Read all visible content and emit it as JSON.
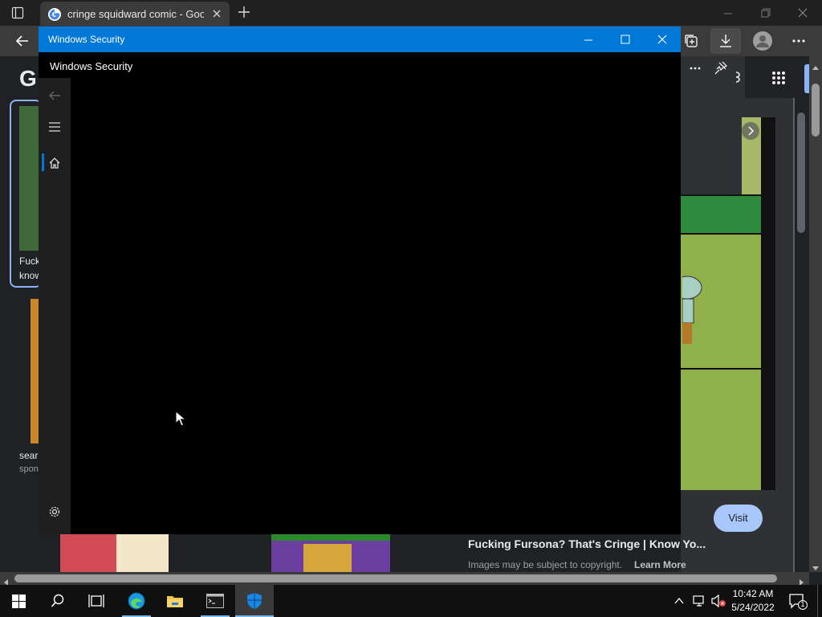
{
  "browser": {
    "tab_title": "cringe squidward comic - Google",
    "page": {
      "google_letter": "G",
      "left_card_text": [
        "Fuck",
        "know"
      ],
      "left_card2_text": [
        "sear",
        "spon"
      ],
      "result_title": "Fucking Fursona? That's Cringe | Know Yo...",
      "copyright_text": "Images may be subject to copyright.",
      "learn_more": "Learn More",
      "visit_button": "Visit"
    }
  },
  "window": {
    "title": "Windows Security",
    "app_header": "Windows Security",
    "nav_items": [
      "back-icon",
      "menu-icon",
      "home-icon",
      "settings-icon"
    ]
  },
  "taskbar": {
    "items": [
      "start",
      "search",
      "task-view",
      "edge",
      "file-explorer",
      "terminal",
      "windows-security"
    ],
    "time": "10:42 AM",
    "date": "5/24/2022",
    "notification_count": "1"
  },
  "colors": {
    "title_bar": "#0078d7",
    "taskbar": "#101010",
    "browser_dark": "#202124",
    "visit_button": "#a8c7fa"
  }
}
